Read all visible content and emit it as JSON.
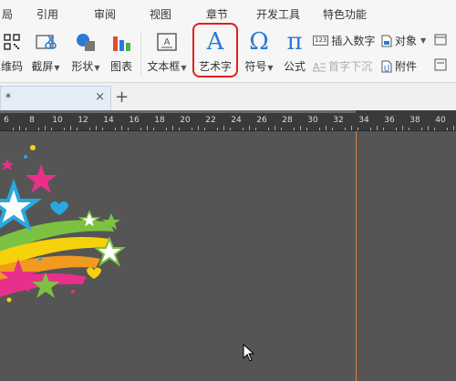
{
  "menu": {
    "items": [
      {
        "label": "局",
        "name": "menu-partial"
      },
      {
        "label": "引用",
        "name": "menu-references"
      },
      {
        "label": "审阅",
        "name": "menu-review"
      },
      {
        "label": "视图",
        "name": "menu-view"
      },
      {
        "label": "章节",
        "name": "menu-chapter"
      },
      {
        "label": "开发工具",
        "name": "menu-developer"
      },
      {
        "label": "特色功能",
        "name": "menu-features"
      }
    ]
  },
  "ribbon": {
    "qrcode_label": "维码",
    "screenshot_label": "截屏",
    "shapes_label": "形状",
    "chart_label": "图表",
    "textbox_label": "文本框",
    "wordart_label": "艺术字",
    "symbol_label": "符号",
    "formula_label": "公式",
    "insert_number_label": "插入数字",
    "dropcap_label": "首字下沉",
    "object_label": "对象",
    "attachment_label": "附件",
    "number_badge": "123",
    "wordart_glyph": "A",
    "symbol_glyph": "Ω",
    "formula_glyph": "π"
  },
  "tabs": {
    "doc_name": "*",
    "close": "×",
    "new": "+"
  },
  "ruler": {
    "ticks": [
      "6",
      "8",
      "10",
      "12",
      "14",
      "16",
      "18",
      "20",
      "22",
      "24",
      "26",
      "28",
      "30",
      "32",
      "34",
      "36",
      "38",
      "40"
    ]
  },
  "colors": {
    "highlight": "#e02020",
    "accent_blue": "#2b79d6",
    "canvas": "#555555",
    "guide": "#e0803a"
  }
}
